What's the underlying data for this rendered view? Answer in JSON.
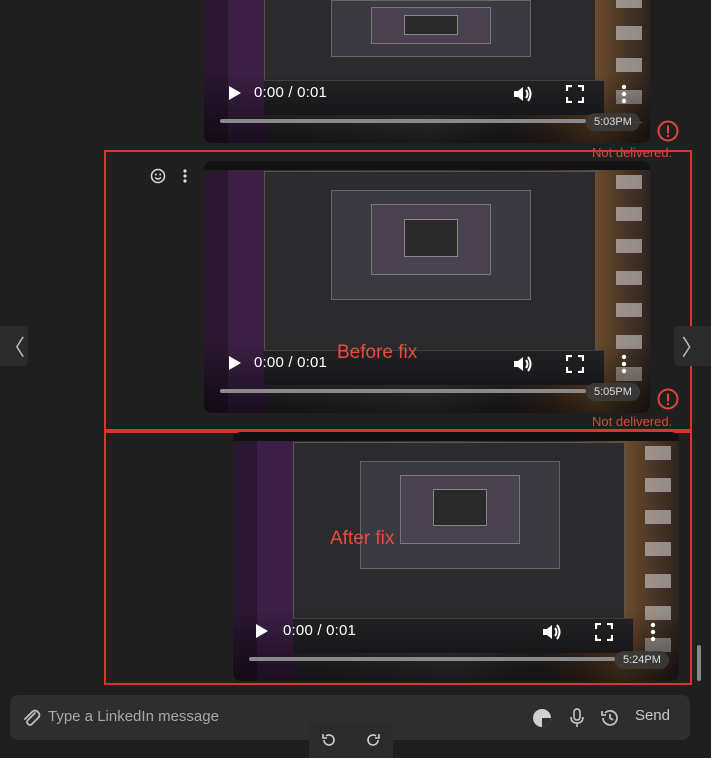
{
  "messages": [
    {
      "time_current": "0:00",
      "time_total": "0:01",
      "separator": " / ",
      "timestamp": "5:03PM",
      "status": "Not delivered.",
      "progress": 0
    },
    {
      "time_current": "0:00",
      "time_total": "0:01",
      "separator": " / ",
      "timestamp": "5:05PM",
      "status": "Not delivered.",
      "annotation": "Before fix",
      "progress": 0
    },
    {
      "time_current": "0:00",
      "time_total": "0:01",
      "separator": " / ",
      "timestamp": "5:24PM",
      "annotation": "After fix",
      "progress": 0
    }
  ],
  "navigation": {
    "prev": "〈",
    "next": "〉"
  },
  "composer": {
    "placeholder": "Type a LinkedIn message",
    "send_label": "Send"
  },
  "colors": {
    "annotation": "#ea4b3c",
    "highlight_border": "#d8362c",
    "error": "#e0453a",
    "background": "#1f1f1f"
  }
}
